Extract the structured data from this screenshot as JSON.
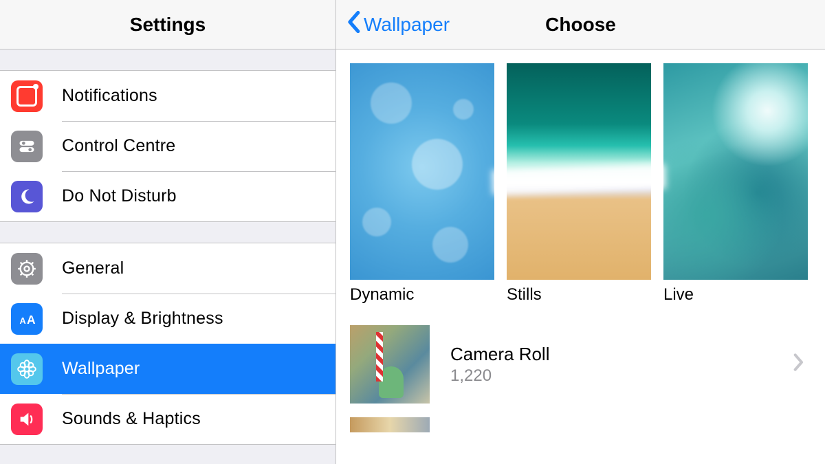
{
  "sidebar": {
    "title": "Settings",
    "groups": [
      {
        "items": [
          {
            "label": "Notifications",
            "icon": "notifications",
            "selected": false
          },
          {
            "label": "Control Centre",
            "icon": "control-centre",
            "selected": false
          },
          {
            "label": "Do Not Disturb",
            "icon": "do-not-disturb",
            "selected": false
          }
        ]
      },
      {
        "items": [
          {
            "label": "General",
            "icon": "general",
            "selected": false
          },
          {
            "label": "Display & Brightness",
            "icon": "display-brightness",
            "selected": false
          },
          {
            "label": "Wallpaper",
            "icon": "wallpaper",
            "selected": true
          },
          {
            "label": "Sounds & Haptics",
            "icon": "sounds-haptics",
            "selected": false
          }
        ]
      }
    ]
  },
  "detail": {
    "back_label": "Wallpaper",
    "title": "Choose",
    "categories": [
      {
        "label": "Dynamic"
      },
      {
        "label": "Stills"
      },
      {
        "label": "Live"
      }
    ],
    "albums": [
      {
        "title": "Camera Roll",
        "count": "1,220"
      }
    ]
  },
  "colors": {
    "accent": "#147efb",
    "separator": "#c2c2c4",
    "background": "#efeff4"
  }
}
